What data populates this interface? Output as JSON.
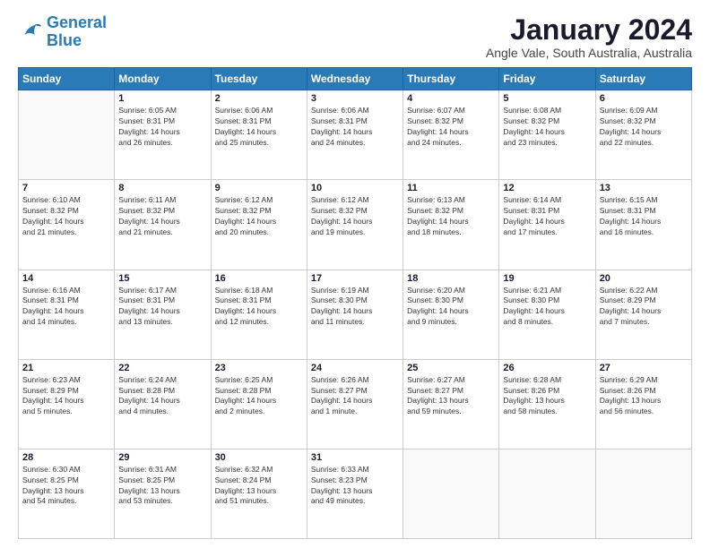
{
  "logo": {
    "line1": "General",
    "line2": "Blue"
  },
  "title": "January 2024",
  "subtitle": "Angle Vale, South Australia, Australia",
  "days_of_week": [
    "Sunday",
    "Monday",
    "Tuesday",
    "Wednesday",
    "Thursday",
    "Friday",
    "Saturday"
  ],
  "weeks": [
    [
      {
        "day": "",
        "info": ""
      },
      {
        "day": "1",
        "info": "Sunrise: 6:05 AM\nSunset: 8:31 PM\nDaylight: 14 hours\nand 26 minutes."
      },
      {
        "day": "2",
        "info": "Sunrise: 6:06 AM\nSunset: 8:31 PM\nDaylight: 14 hours\nand 25 minutes."
      },
      {
        "day": "3",
        "info": "Sunrise: 6:06 AM\nSunset: 8:31 PM\nDaylight: 14 hours\nand 24 minutes."
      },
      {
        "day": "4",
        "info": "Sunrise: 6:07 AM\nSunset: 8:32 PM\nDaylight: 14 hours\nand 24 minutes."
      },
      {
        "day": "5",
        "info": "Sunrise: 6:08 AM\nSunset: 8:32 PM\nDaylight: 14 hours\nand 23 minutes."
      },
      {
        "day": "6",
        "info": "Sunrise: 6:09 AM\nSunset: 8:32 PM\nDaylight: 14 hours\nand 22 minutes."
      }
    ],
    [
      {
        "day": "7",
        "info": "Sunrise: 6:10 AM\nSunset: 8:32 PM\nDaylight: 14 hours\nand 21 minutes."
      },
      {
        "day": "8",
        "info": "Sunrise: 6:11 AM\nSunset: 8:32 PM\nDaylight: 14 hours\nand 21 minutes."
      },
      {
        "day": "9",
        "info": "Sunrise: 6:12 AM\nSunset: 8:32 PM\nDaylight: 14 hours\nand 20 minutes."
      },
      {
        "day": "10",
        "info": "Sunrise: 6:12 AM\nSunset: 8:32 PM\nDaylight: 14 hours\nand 19 minutes."
      },
      {
        "day": "11",
        "info": "Sunrise: 6:13 AM\nSunset: 8:32 PM\nDaylight: 14 hours\nand 18 minutes."
      },
      {
        "day": "12",
        "info": "Sunrise: 6:14 AM\nSunset: 8:31 PM\nDaylight: 14 hours\nand 17 minutes."
      },
      {
        "day": "13",
        "info": "Sunrise: 6:15 AM\nSunset: 8:31 PM\nDaylight: 14 hours\nand 16 minutes."
      }
    ],
    [
      {
        "day": "14",
        "info": "Sunrise: 6:16 AM\nSunset: 8:31 PM\nDaylight: 14 hours\nand 14 minutes."
      },
      {
        "day": "15",
        "info": "Sunrise: 6:17 AM\nSunset: 8:31 PM\nDaylight: 14 hours\nand 13 minutes."
      },
      {
        "day": "16",
        "info": "Sunrise: 6:18 AM\nSunset: 8:31 PM\nDaylight: 14 hours\nand 12 minutes."
      },
      {
        "day": "17",
        "info": "Sunrise: 6:19 AM\nSunset: 8:30 PM\nDaylight: 14 hours\nand 11 minutes."
      },
      {
        "day": "18",
        "info": "Sunrise: 6:20 AM\nSunset: 8:30 PM\nDaylight: 14 hours\nand 9 minutes."
      },
      {
        "day": "19",
        "info": "Sunrise: 6:21 AM\nSunset: 8:30 PM\nDaylight: 14 hours\nand 8 minutes."
      },
      {
        "day": "20",
        "info": "Sunrise: 6:22 AM\nSunset: 8:29 PM\nDaylight: 14 hours\nand 7 minutes."
      }
    ],
    [
      {
        "day": "21",
        "info": "Sunrise: 6:23 AM\nSunset: 8:29 PM\nDaylight: 14 hours\nand 5 minutes."
      },
      {
        "day": "22",
        "info": "Sunrise: 6:24 AM\nSunset: 8:28 PM\nDaylight: 14 hours\nand 4 minutes."
      },
      {
        "day": "23",
        "info": "Sunrise: 6:25 AM\nSunset: 8:28 PM\nDaylight: 14 hours\nand 2 minutes."
      },
      {
        "day": "24",
        "info": "Sunrise: 6:26 AM\nSunset: 8:27 PM\nDaylight: 14 hours\nand 1 minute."
      },
      {
        "day": "25",
        "info": "Sunrise: 6:27 AM\nSunset: 8:27 PM\nDaylight: 13 hours\nand 59 minutes."
      },
      {
        "day": "26",
        "info": "Sunrise: 6:28 AM\nSunset: 8:26 PM\nDaylight: 13 hours\nand 58 minutes."
      },
      {
        "day": "27",
        "info": "Sunrise: 6:29 AM\nSunset: 8:26 PM\nDaylight: 13 hours\nand 56 minutes."
      }
    ],
    [
      {
        "day": "28",
        "info": "Sunrise: 6:30 AM\nSunset: 8:25 PM\nDaylight: 13 hours\nand 54 minutes."
      },
      {
        "day": "29",
        "info": "Sunrise: 6:31 AM\nSunset: 8:25 PM\nDaylight: 13 hours\nand 53 minutes."
      },
      {
        "day": "30",
        "info": "Sunrise: 6:32 AM\nSunset: 8:24 PM\nDaylight: 13 hours\nand 51 minutes."
      },
      {
        "day": "31",
        "info": "Sunrise: 6:33 AM\nSunset: 8:23 PM\nDaylight: 13 hours\nand 49 minutes."
      },
      {
        "day": "",
        "info": ""
      },
      {
        "day": "",
        "info": ""
      },
      {
        "day": "",
        "info": ""
      }
    ]
  ]
}
